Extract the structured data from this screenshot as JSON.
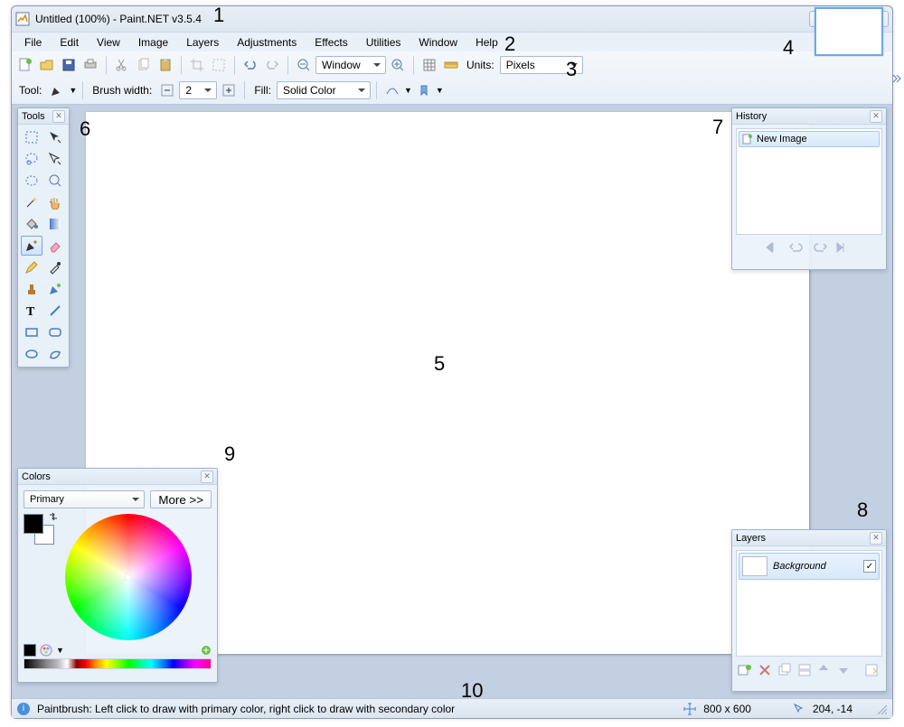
{
  "window": {
    "title": "Untitled (100%) - Paint.NET v3.5.4"
  },
  "menu": [
    "File",
    "Edit",
    "View",
    "Image",
    "Layers",
    "Adjustments",
    "Effects",
    "Utilities",
    "Window",
    "Help"
  ],
  "toolbar": {
    "zoom_mode": "Window",
    "units_label": "Units:",
    "units_value": "Pixels",
    "tool_label": "Tool:",
    "brush_width_label": "Brush width:",
    "brush_width_value": "2",
    "fill_label": "Fill:",
    "fill_value": "Solid Color"
  },
  "panels": {
    "tools_title": "Tools",
    "history_title": "History",
    "history_items": [
      "New Image"
    ],
    "layers_title": "Layers",
    "layers_items": [
      {
        "name": "Background",
        "visible": true
      }
    ],
    "colors_title": "Colors",
    "colors_selector": "Primary",
    "colors_more": "More >>"
  },
  "status": {
    "help": "Paintbrush: Left click to draw with primary color, right click to draw with secondary color",
    "dimensions": "800 x 600",
    "cursor": "204, -14"
  },
  "annotations": {
    "1": "1",
    "2": "2",
    "3": "3",
    "4": "4",
    "5": "5",
    "6": "6",
    "7": "7",
    "8": "8",
    "9": "9",
    "10": "10"
  }
}
